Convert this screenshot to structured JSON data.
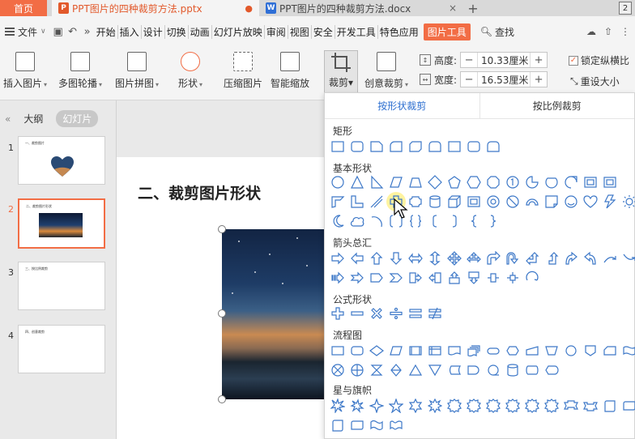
{
  "tabs": {
    "home": "首页",
    "doc1": {
      "icon": "P",
      "title": "PPT图片的四种裁剪方法.pptx",
      "dot": "●"
    },
    "doc2": {
      "icon": "W",
      "title": "PPT图片的四种裁剪方法.docx",
      "close": "×"
    },
    "new": "+",
    "count": "2"
  },
  "menu": {
    "file": "文件",
    "items": [
      "开始",
      "插入",
      "设计",
      "切换",
      "动画",
      "幻灯片放映",
      "审阅",
      "视图",
      "安全",
      "开发工具",
      "特色应用"
    ],
    "pic_tools": "图片工具",
    "search": "查找"
  },
  "toolbar": {
    "insert_pic": "插入图片",
    "multi_outline": "多图轮播",
    "pic_collage": "图片拼图",
    "shape": "形状",
    "compress": "压缩图片",
    "smart_zoom": "智能缩放",
    "crop": "裁剪",
    "creative_crop": "创意裁剪",
    "height_label": "高度:",
    "height_value": "10.33厘米",
    "width_label": "宽度:",
    "width_value": "16.53厘米",
    "lock_ratio": "锁定纵横比",
    "lock_checked": "✓",
    "reset_size": "重设大小"
  },
  "panel": {
    "collapse": "«",
    "outline_tab": "大纲",
    "slides_tab": "幻灯片",
    "thumbs": [
      {
        "num": "1",
        "title": "一、裁剪图片"
      },
      {
        "num": "2",
        "title": "二、裁剪图片形状"
      },
      {
        "num": "3",
        "title": "三、按比例裁剪"
      },
      {
        "num": "4",
        "title": "四、创意裁剪"
      }
    ]
  },
  "slide": {
    "title": "二、裁剪图片形状"
  },
  "crop_panel": {
    "tab_shape": "按形状裁剪",
    "tab_ratio": "按比例裁剪",
    "sections": {
      "rect": "矩形",
      "basic": "基本形状",
      "arrows": "箭头总汇",
      "formula": "公式形状",
      "flow": "流程图",
      "stars": "星与旗帜"
    }
  }
}
